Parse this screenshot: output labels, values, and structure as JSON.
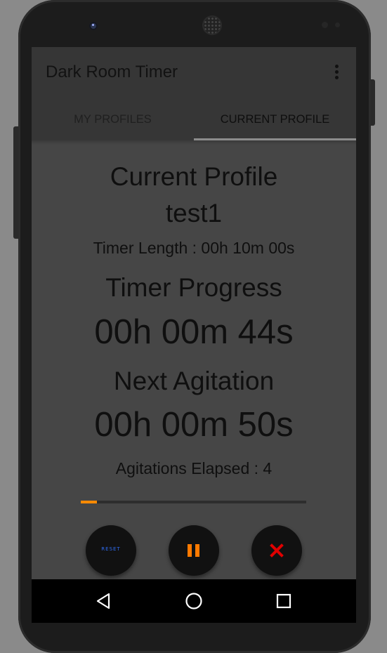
{
  "app": {
    "title": "Dark Room Timer",
    "menu_icon": "more-vert-icon"
  },
  "tabs": [
    {
      "label": "MY PROFILES",
      "selected": false
    },
    {
      "label": "CURRENT PROFILE",
      "selected": true
    }
  ],
  "profile": {
    "heading": "Current Profile",
    "name": "test1",
    "timer_length": "Timer Length : 00h 10m 00s",
    "progress_label": "Timer Progress",
    "progress_value": "00h 00m 44s",
    "next_label": "Next Agitation",
    "next_value": "00h 00m 50s",
    "agitations": "Agitations Elapsed : 4",
    "progress_fraction": 0.073
  },
  "controls": {
    "reset_label": "RESET",
    "pause_icon": "pause-icon",
    "stop_icon": "close-icon"
  },
  "navbar": {
    "back_icon": "back-icon",
    "home_icon": "home-icon",
    "recents_icon": "recents-icon"
  },
  "colors": {
    "accent": "#ff8a00",
    "reset_text": "#2f6cf0",
    "stop_icon": "#e00000",
    "screen_bg": "#464646",
    "appbar_bg": "#363636"
  }
}
